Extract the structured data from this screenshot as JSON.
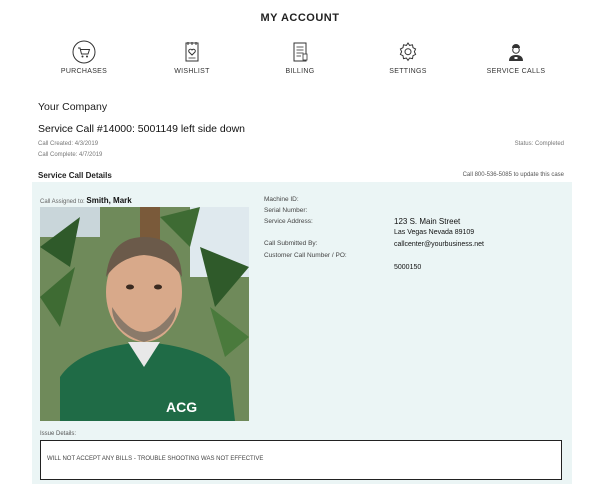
{
  "page": {
    "title": "MY ACCOUNT"
  },
  "nav": {
    "items": [
      {
        "label": "PURCHASES",
        "icon": "cart-icon"
      },
      {
        "label": "WISHLIST",
        "icon": "wishlist-icon"
      },
      {
        "label": "BILLING",
        "icon": "billing-icon"
      },
      {
        "label": "SETTINGS",
        "icon": "gear-icon"
      },
      {
        "label": "SERVICE CALLS",
        "icon": "technician-icon"
      }
    ]
  },
  "company": {
    "name": "Your Company"
  },
  "service_call": {
    "title": "Service Call #14000: 5001149   left side down",
    "created_label": "Call Created:",
    "created_value": "4/3/2019",
    "complete_label": "Call Complete:",
    "complete_value": "4/7/2019",
    "status_label": "Status:",
    "status_value": "Completed"
  },
  "details": {
    "heading": "Service Call Details",
    "update_text": "Call 800-536-5085 to update this case",
    "assigned_label": "Call Assigned to:",
    "assigned_name": "Smith, Mark",
    "photo_logo": "ACG",
    "fields": {
      "machine_id_label": "Machine ID:",
      "serial_label": "Serial Number:",
      "address_label": "Service Address:",
      "address_line1": "123 S. Main Street",
      "address_line2": "Las Vegas Nevada 89109",
      "submitted_label": "Call Submitted By:",
      "submitted_value": "callcenter@yourbusiness.net",
      "customer_po_label": "Customer Call Number / PO:",
      "customer_po_value": "5000150"
    },
    "issue_label": "Issue Details:",
    "issue_text": "WILL NOT ACCEPT ANY BILLS - TROUBLE SHOOTING WAS NOT EFFECTIVE"
  },
  "colors": {
    "panel_bg": "#ebf5f5",
    "text": "#222222",
    "shirt": "#1f6b46"
  }
}
